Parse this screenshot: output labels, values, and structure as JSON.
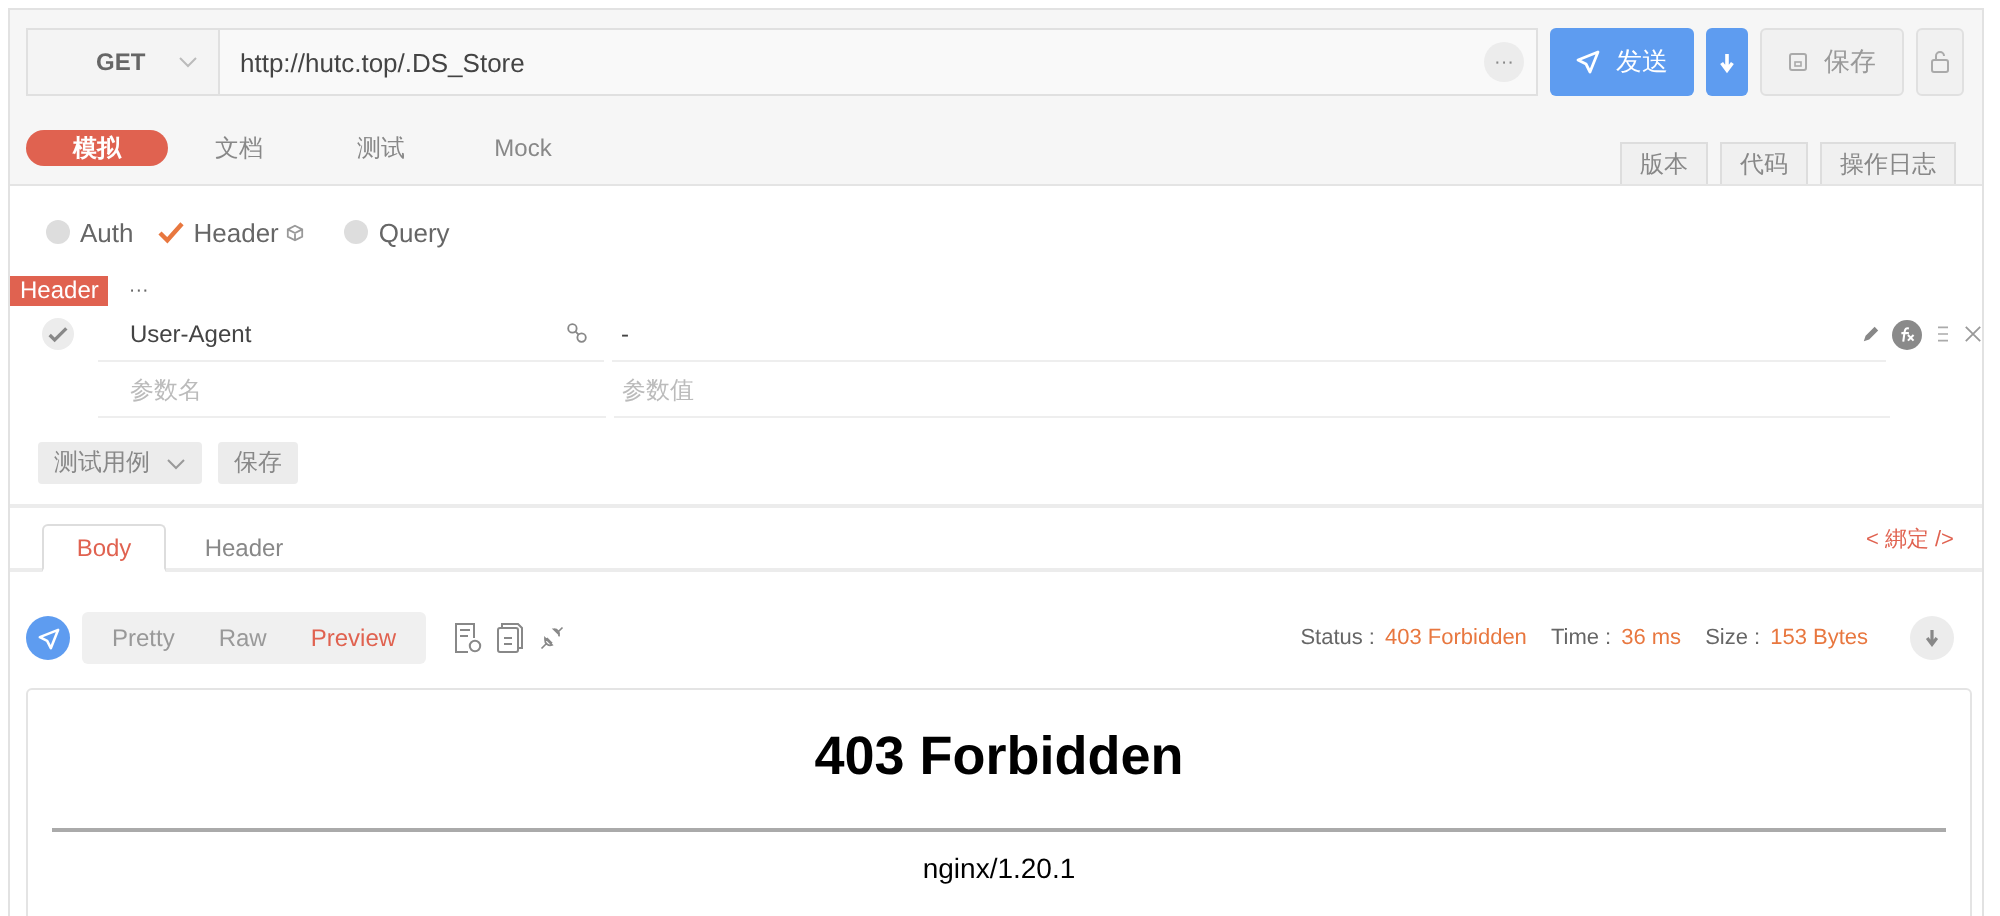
{
  "request": {
    "method": "GET",
    "url": "http://hutc.top/.DS_Store",
    "more": "···",
    "send": "发送",
    "save": "保存"
  },
  "tabs": [
    {
      "label": "模拟",
      "selected": true
    },
    {
      "label": "文档",
      "selected": false
    },
    {
      "label": "测试",
      "selected": false
    },
    {
      "label": "Mock",
      "selected": false
    }
  ],
  "side_tabs": [
    "版本",
    "代码",
    "操作日志"
  ],
  "param_types": [
    {
      "label": "Auth",
      "selected": false
    },
    {
      "label": "Header",
      "selected": true
    },
    {
      "label": "Query",
      "selected": false
    }
  ],
  "header_section": {
    "tag": "Header",
    "more": "···"
  },
  "headers": [
    {
      "name": "User-Agent",
      "value": "-",
      "checked": true
    }
  ],
  "new_header": {
    "name_placeholder": "参数名",
    "value_placeholder": "参数值"
  },
  "actions": {
    "test_case": "测试用例",
    "save": "保存"
  },
  "response_tabs": [
    {
      "label": "Body",
      "selected": true
    },
    {
      "label": "Header",
      "selected": false
    }
  ],
  "bind": "< 綁定 />",
  "formats": [
    {
      "label": "Pretty",
      "selected": false
    },
    {
      "label": "Raw",
      "selected": false
    },
    {
      "label": "Preview",
      "selected": true
    }
  ],
  "status": [
    {
      "label": "Status :",
      "value": "403 Forbidden"
    },
    {
      "label": "Time :",
      "value": "36 ms"
    },
    {
      "label": "Size :",
      "value": "153 Bytes"
    }
  ],
  "preview": {
    "heading": "403 Forbidden",
    "footer": "nginx/1.20.1"
  }
}
